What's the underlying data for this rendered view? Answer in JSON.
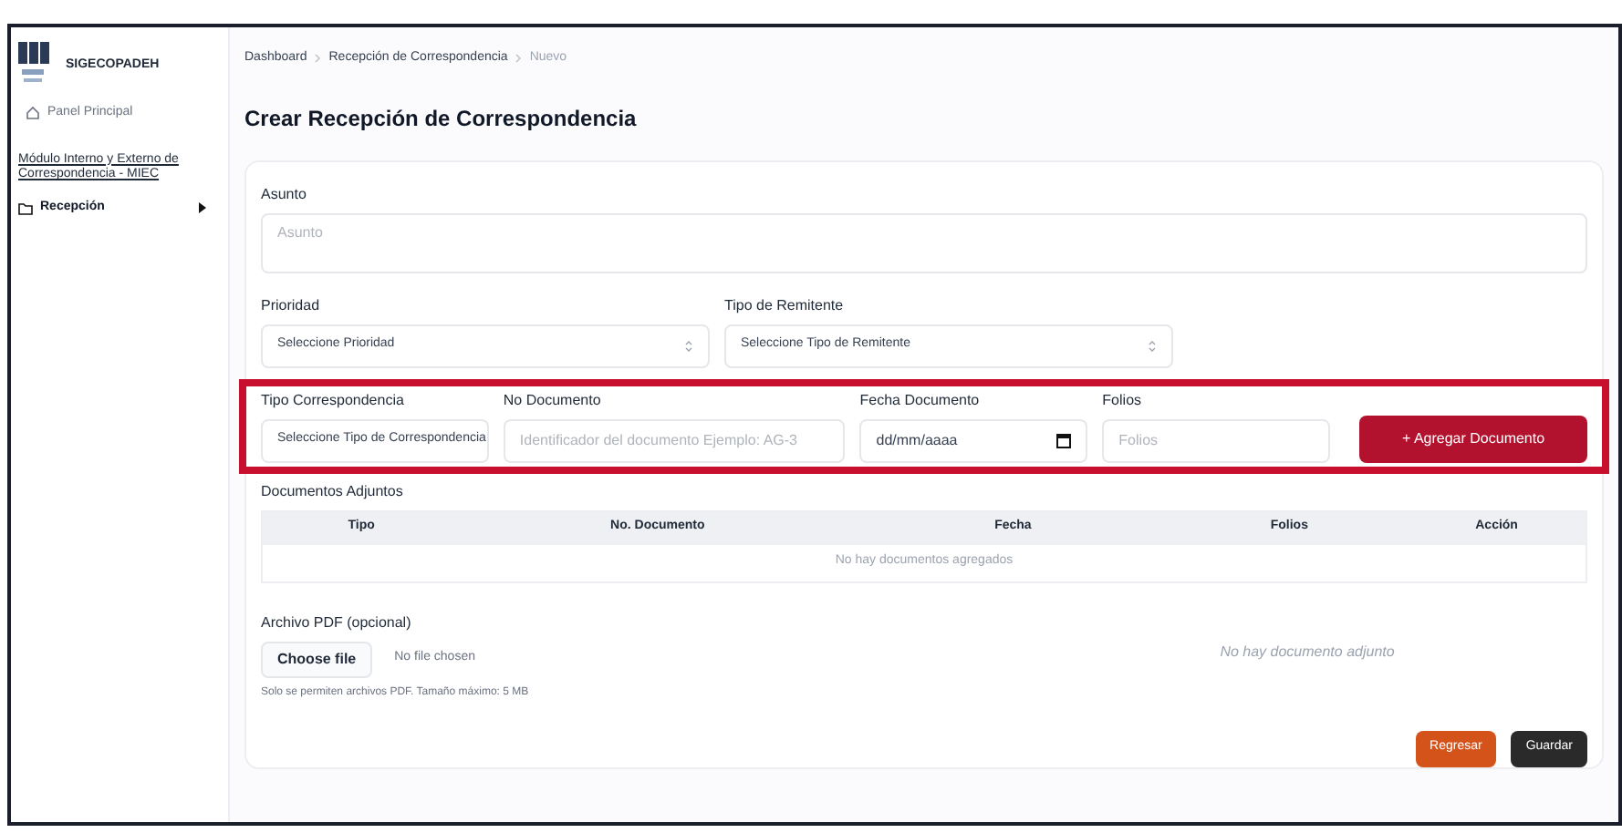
{
  "sidebar": {
    "brand": "SIGECOPADEH",
    "home": "Panel Principal",
    "module_link": "Módulo Interno y Externo de Correspondencia - MIEC",
    "items": [
      {
        "label": "Recepción",
        "selected": true
      }
    ]
  },
  "breadcrumb": [
    "Dashboard",
    "Recepción de Correspondencia",
    "Nuevo"
  ],
  "title": "Crear Recepción de Correspondencia",
  "asunto": {
    "label": "Asunto",
    "placeholder": "Asunto"
  },
  "row1": [
    {
      "kind": "select",
      "label": "Prioridad",
      "value": "Seleccione Prioridad"
    },
    {
      "kind": "select",
      "label": "Tipo de Remitente",
      "value": "Seleccione Tipo de Remitente"
    }
  ],
  "row2": [
    {
      "kind": "select",
      "label": "Tipo Correspondencia",
      "value": "Seleccione Tipo de Correspondencia"
    },
    {
      "kind": "text",
      "label": "No Documento",
      "placeholder": "Identificador del documento Ejemplo: AG-3"
    },
    {
      "kind": "date",
      "label": "Fecha Documento",
      "value": "dd/mm/aaaa"
    },
    {
      "kind": "text",
      "label": "Folios",
      "placeholder": "Folios"
    }
  ],
  "add_button": "+ Agregar Documento",
  "documents": {
    "title": "Documentos Adjuntos",
    "columns": [
      "Tipo",
      "No. Documento",
      "Fecha",
      "Folios",
      "Acción"
    ],
    "empty": "No hay documentos agregados"
  },
  "pdf": {
    "label": "Archivo PDF (opcional)",
    "button": "Choose file",
    "status": "No file chosen",
    "hint": "Solo se permiten archivos PDF. Tamaño máximo: 5 MB",
    "preview_empty": "No hay documento adjunto"
  },
  "actions": [
    {
      "label": "Regresar",
      "kind": "secondary"
    },
    {
      "label": "Guardar",
      "kind": "primary"
    }
  ]
}
